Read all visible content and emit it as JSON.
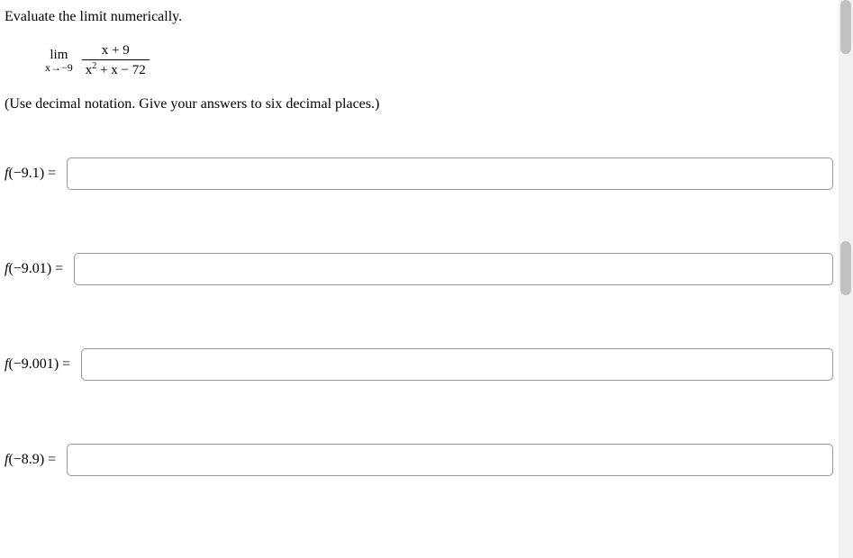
{
  "question_text": "Evaluate the limit numerically.",
  "limit": {
    "lim_text": "lim",
    "approach": "x→−9",
    "numerator": "x + 9",
    "denominator_pre": "x",
    "denominator_sup": "2",
    "denominator_post": " + x − 72"
  },
  "instruction": "(Use decimal notation. Give your answers to six decimal places.)",
  "rows": [
    {
      "fn": "f",
      "arg": "−9.1",
      "value": ""
    },
    {
      "fn": "f",
      "arg": "−9.01",
      "value": ""
    },
    {
      "fn": "f",
      "arg": "−9.001",
      "value": ""
    },
    {
      "fn": "f",
      "arg": "−8.9",
      "value": ""
    }
  ],
  "eq": "="
}
